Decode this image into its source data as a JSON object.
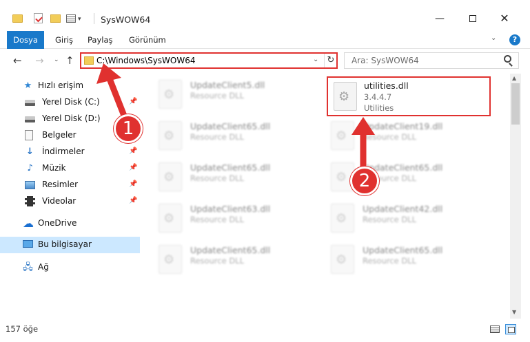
{
  "window": {
    "title": "SysWOW64",
    "minimize_glyph": "—",
    "close_glyph": "✕"
  },
  "ribbon": {
    "tabs": [
      "Dosya",
      "Giriş",
      "Paylaş",
      "Görünüm"
    ],
    "expand_glyph": "⌄",
    "help_glyph": "?"
  },
  "navigation": {
    "back_glyph": "←",
    "forward_glyph": "→",
    "recent_glyph": "⌄",
    "up_glyph": "↑",
    "address": "C:\\Windows\\SysWOW64",
    "address_dropdown_glyph": "⌄",
    "refresh_glyph": "↻",
    "search_placeholder": "Ara: SysWOW64"
  },
  "sidebar": {
    "items": [
      {
        "label": "Hızlı erişim",
        "icon": "star-icon",
        "pinned": false
      },
      {
        "label": "Yerel Disk (C:)",
        "icon": "drive-icon",
        "pinned": true
      },
      {
        "label": "Yerel Disk (D:)",
        "icon": "drive-icon",
        "pinned": false
      },
      {
        "label": "Belgeler",
        "icon": "documents-icon",
        "pinned": false
      },
      {
        "label": "İndirmeler",
        "icon": "downloads-icon",
        "pinned": true
      },
      {
        "label": "Müzik",
        "icon": "music-icon",
        "pinned": true
      },
      {
        "label": "Resimler",
        "icon": "pictures-icon",
        "pinned": true
      },
      {
        "label": "Videolar",
        "icon": "videos-icon",
        "pinned": true
      },
      {
        "label": "OneDrive",
        "icon": "onedrive-icon",
        "pinned": false
      },
      {
        "label": "Bu bilgisayar",
        "icon": "this-pc-icon",
        "pinned": false,
        "selected": true
      },
      {
        "label": "Ağ",
        "icon": "network-icon",
        "pinned": false
      }
    ],
    "pin_glyph": "📌"
  },
  "files": [
    {
      "name": "UpdateClient5.dll",
      "type": "Resource DLL",
      "blurred": true
    },
    {
      "name": "utilities.dll",
      "version": "3.4.4.7",
      "description": "Utilities",
      "highlighted": true
    },
    {
      "name": "UpdateClient65.dll",
      "type": "Resource DLL",
      "blurred": true
    },
    {
      "name": "UpdateClient19.dll",
      "type": "Resource DLL",
      "blurred": true
    },
    {
      "name": "UpdateClient65.dll",
      "type": "Resource DLL",
      "blurred": true
    },
    {
      "name": "UpdateClient65.dll",
      "type": "Resource DLL",
      "blurred": true
    },
    {
      "name": "UpdateClient63.dll",
      "type": "Resource DLL",
      "blurred": true
    },
    {
      "name": "UpdateClient42.dll",
      "type": "Resource DLL",
      "blurred": true
    },
    {
      "name": "UpdateClient65.dll",
      "type": "Resource DLL",
      "blurred": true
    },
    {
      "name": "UpdateClient65.dll",
      "type": "Resource DLL",
      "blurred": true
    }
  ],
  "scrollbar": {
    "up_glyph": "▲",
    "down_glyph": "▼"
  },
  "status": {
    "item_count": "157 öğe"
  },
  "annotations": {
    "callout1": "1",
    "callout2": "2",
    "color": "#e0312f"
  },
  "colors": {
    "accent": "#1979ca",
    "selection": "#cce8ff",
    "highlight": "#e0312f"
  }
}
